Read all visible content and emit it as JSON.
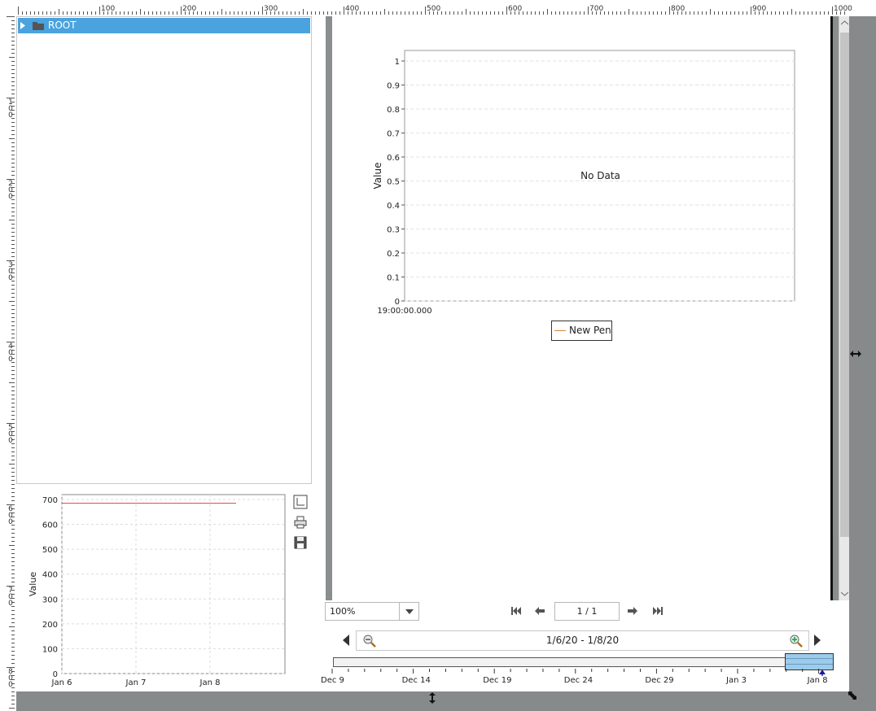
{
  "ruler": {
    "h_labels": [
      "100",
      "200",
      "300",
      "400",
      "500",
      "600",
      "700",
      "800",
      "900",
      "1000"
    ],
    "v_labels": [
      "100",
      "200",
      "300",
      "400",
      "500",
      "600",
      "700",
      "800"
    ]
  },
  "tree": {
    "root_label": "ROOT"
  },
  "mini_chart": {
    "ylabel": "Value",
    "y_ticks": [
      "0",
      "100",
      "200",
      "300",
      "400",
      "500",
      "600",
      "700"
    ],
    "x_ticks": [
      "Jan 6",
      "Jan 7",
      "Jan 8"
    ]
  },
  "side_icons": [
    "fit-icon",
    "print-icon",
    "save-icon"
  ],
  "report": {
    "no_data_text": "No Data",
    "legend_label": "New Pen",
    "toolbar": {
      "zoom_value": "100%",
      "page_indicator": "1 / 1"
    }
  },
  "date_range": {
    "label": "1/6/20 - 1/8/20",
    "axis_labels": [
      "Dec 9",
      "Dec 14",
      "Dec 19",
      "Dec 24",
      "Dec 29",
      "Jan 3",
      "Jan 8"
    ]
  },
  "chart_data": [
    {
      "type": "line",
      "ylabel": "Value",
      "x_tick_labels": [
        "Jan 6",
        "Jan 7",
        "Jan 8"
      ],
      "y_tick_labels": [
        "0",
        "100",
        "200",
        "300",
        "400",
        "500",
        "600",
        "700"
      ],
      "ylim": [
        0,
        700
      ],
      "series": [
        {
          "color": "#d9463b",
          "x": [
            "Jan 6",
            "Jan 8.35"
          ],
          "values": [
            685,
            685
          ]
        }
      ],
      "grid": true
    },
    {
      "type": "line",
      "ylabel": "Value",
      "y_tick_labels": [
        "0",
        "0.1",
        "0.2",
        "0.3",
        "0.4",
        "0.5",
        "0.6",
        "0.7",
        "0.8",
        "0.9",
        "1"
      ],
      "x_tick_labels": [
        "19:00:00.000"
      ],
      "ylim": [
        0,
        1
      ],
      "series": [
        {
          "name": "New Pen",
          "color": "#d9833b",
          "values": []
        }
      ],
      "annotation": "No Data",
      "legend": "bottom-center",
      "grid": true
    }
  ],
  "colors": {
    "selection": "#4aa3df",
    "viewer_bg": "#8a8e8e",
    "range_thumb": "#9ccbeb",
    "mini_line": "#d9463b",
    "pen_line": "#d9833b"
  }
}
